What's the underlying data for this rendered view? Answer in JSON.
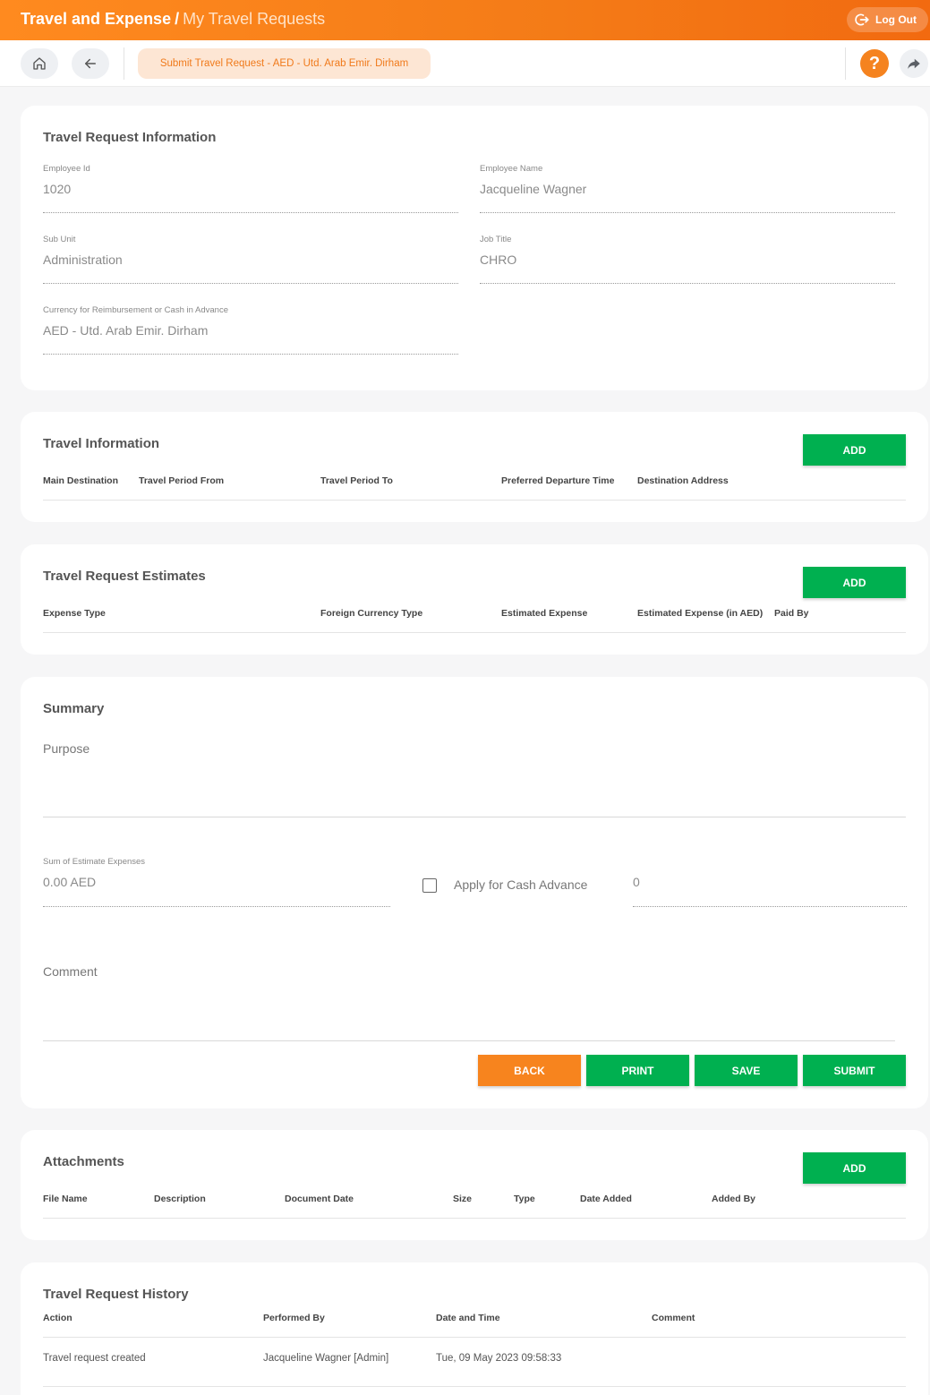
{
  "header": {
    "app_title": "Travel and Expense",
    "separator": "/",
    "page_title": "My Travel Requests",
    "logout_label": "Log Out"
  },
  "nav": {
    "breadcrumb": "Submit Travel Request - AED - Utd. Arab Emir. Dirham",
    "help_symbol": "?"
  },
  "request_info": {
    "title": "Travel Request Information",
    "employee_id": {
      "label": "Employee Id",
      "value": "1020"
    },
    "employee_name": {
      "label": "Employee Name",
      "value": "Jacqueline Wagner"
    },
    "sub_unit": {
      "label": "Sub Unit",
      "value": "Administration"
    },
    "job_title": {
      "label": "Job Title",
      "value": "CHRO"
    },
    "currency": {
      "label": "Currency for Reimbursement or Cash in Advance",
      "value": "AED - Utd. Arab Emir. Dirham"
    }
  },
  "travel_info": {
    "title": "Travel Information",
    "add_label": "ADD",
    "columns": [
      "Main Destination",
      "Travel Period From",
      "Travel Period To",
      "Preferred Departure Time",
      "Destination Address"
    ]
  },
  "estimates": {
    "title": "Travel Request Estimates",
    "add_label": "ADD",
    "columns": [
      "Expense Type",
      "Foreign Currency Type",
      "Estimated Expense",
      "Estimated Expense (in AED)",
      "Paid By"
    ]
  },
  "summary": {
    "title": "Summary",
    "purpose_label": "Purpose",
    "sum_label": "Sum of Estimate Expenses",
    "sum_value": "0.00 AED",
    "cash_advance_label": "Apply for Cash Advance",
    "cash_advance_checked": false,
    "cash_advance_value": "0",
    "comment_label": "Comment",
    "buttons": {
      "back": "BACK",
      "print": "PRINT",
      "save": "SAVE",
      "submit": "SUBMIT"
    }
  },
  "attachments": {
    "title": "Attachments",
    "add_label": "ADD",
    "columns": [
      "File Name",
      "Description",
      "Document Date",
      "Size",
      "Type",
      "Date Added",
      "Added By"
    ]
  },
  "history": {
    "title": "Travel Request History",
    "columns": [
      "Action",
      "Performed By",
      "Date and Time",
      "Comment"
    ],
    "rows": [
      {
        "action": "Travel request created",
        "performed_by": "Jacqueline Wagner [Admin]",
        "date_time": "Tue, 09 May 2023 09:58:33",
        "comment": ""
      }
    ]
  },
  "colors": {
    "brand_orange": "#f5831f",
    "action_green": "#00b050"
  }
}
